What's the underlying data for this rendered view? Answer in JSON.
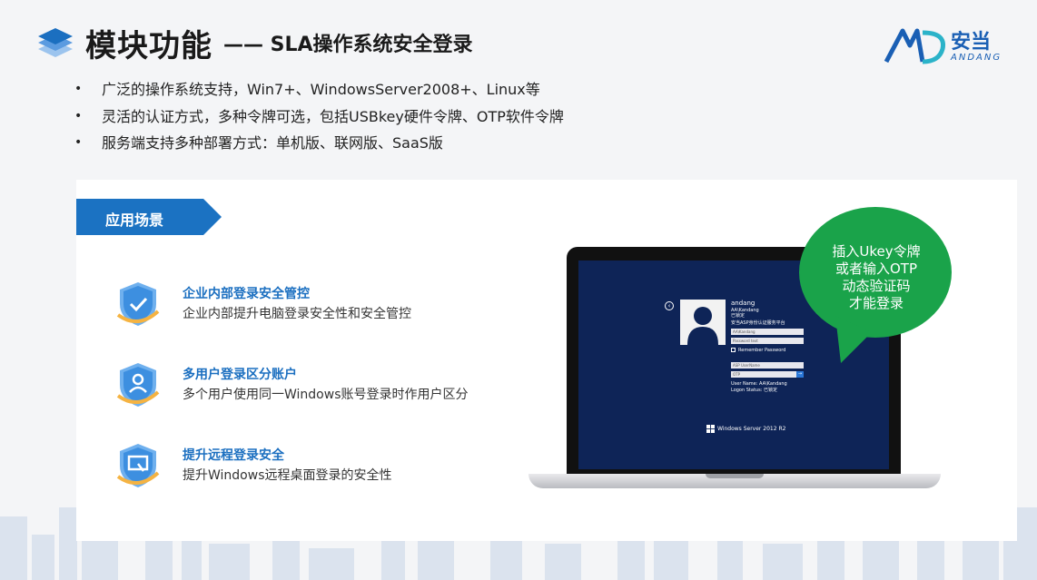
{
  "header": {
    "title": "模块功能",
    "subtitle": "—— SLA操作系统安全登录"
  },
  "logo": {
    "name_cn": "安当",
    "name_en": "ANDANG",
    "brand_color": "#1a5fb4"
  },
  "bullets": [
    "广泛的操作系统支持，Win7+、WindowsServer2008+、Linux等",
    "灵活的认证方式，多种令牌可选，包括USBkey硬件令牌、OTP软件令牌",
    "服务端支持多种部署方式：单机版、联网版、SaaS版"
  ],
  "section": {
    "tag_label": "应用场景",
    "tag_color": "#1b72c2"
  },
  "features": [
    {
      "icon": "shield-check-icon",
      "title": "企业内部登录安全管控",
      "desc": "企业内部提升电脑登录安全性和安全管控"
    },
    {
      "icon": "shield-user-icon",
      "title": "多用户登录区分账户",
      "desc": "多个用户使用同一Windows账号登录时作用户区分"
    },
    {
      "icon": "shield-remote-icon",
      "title": "提升远程登录安全",
      "desc": "提升Windows远程桌面登录的安全性"
    }
  ],
  "login_screen": {
    "username": "andang",
    "account_line": "AA\\Kandang",
    "status_line": "已锁定",
    "platform_label": "安当ASP身份认证服务平台",
    "field_user": "AA\\Kandang",
    "field_password": "Password text",
    "remember": "Remember Password",
    "asp_user_placeholder": "ASP UserName",
    "otp_placeholder": "OTP",
    "submit_arrow": "→",
    "user_name_info": "User Name: AA\\Kandang",
    "logon_status_info": "Logon Status: 已锁定",
    "os_label": "Windows Server 2012 R2",
    "background_color": "#0e2457"
  },
  "bubble": {
    "lines": [
      "插入Ukey令牌",
      "或者输入OTP",
      "动态验证码",
      "才能登录"
    ],
    "color": "#1aa34a"
  }
}
